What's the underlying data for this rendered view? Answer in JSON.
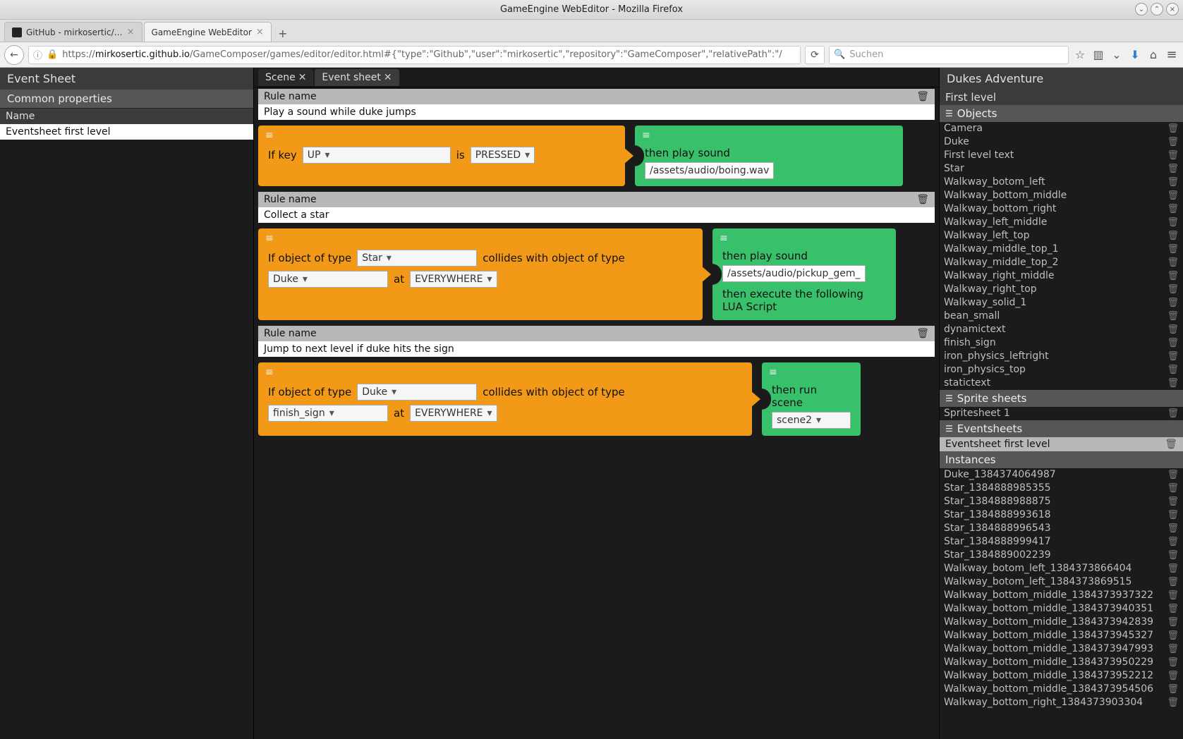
{
  "window": {
    "title": "GameEngine WebEditor - Mozilla Firefox"
  },
  "browser_tabs": [
    {
      "label": "GitHub - mirkosertic/…"
    },
    {
      "label": "GameEngine WebEditor"
    }
  ],
  "url": {
    "scheme": "https://",
    "host": "mirkosertic.github.io",
    "path": "/GameComposer/games/editor/editor.html#{\"type\":\"Github\",\"user\":\"mirkosertic\",\"repository\":\"GameComposer\",\"relativePath\":\"/"
  },
  "search_placeholder": "Suchen",
  "left": {
    "title": "Event Sheet",
    "section": "Common properties",
    "prop_name_label": "Name",
    "prop_name_value": "Eventsheet first level"
  },
  "doc_tabs": [
    {
      "label": "Scene",
      "active": false
    },
    {
      "label": "Event sheet",
      "active": true
    }
  ],
  "rules": [
    {
      "header": "Rule name",
      "name": "Play a sound while duke jumps",
      "orange": {
        "text1": "If key",
        "sel1": "UP",
        "text2": "is",
        "sel2": "PRESSED"
      },
      "green": {
        "lines": [
          {
            "label": "then play sound",
            "value": "/assets/audio/boing.wav"
          }
        ]
      },
      "orange_w": 520,
      "green_w": 380
    },
    {
      "header": "Rule name",
      "name": "Collect a star",
      "orange": {
        "text1": "If object of type",
        "sel1": "Star",
        "text2": "collides with object of type",
        "row2_sel": "Duke",
        "row2_word": "at",
        "row2_sel2": "EVERYWHERE"
      },
      "green": {
        "lines": [
          {
            "label": "then play sound",
            "value": "/assets/audio/pickup_gem_"
          },
          {
            "label": "then execute the following LUA Script"
          }
        ]
      },
      "orange_w": 630,
      "green_w": 260
    },
    {
      "header": "Rule name",
      "name": "Jump to next level if duke hits the sign",
      "orange": {
        "text1": "If object of type",
        "sel1": "Duke",
        "text2": "collides with object of type",
        "row2_sel": "finish_sign",
        "row2_word": "at",
        "row2_sel2": "EVERYWHERE"
      },
      "green": {
        "lines": [
          {
            "label": "then run scene",
            "value": "scene2",
            "is_select": true
          }
        ]
      },
      "orange_w": 700,
      "green_w": 140
    }
  ],
  "right": {
    "project": "Dukes Adventure",
    "scene": "First level",
    "objects_label": "Objects",
    "objects": [
      "Camera",
      "Duke",
      "First level text",
      "Star",
      "Walkway_botom_left",
      "Walkway_bottom_middle",
      "Walkway_bottom_right",
      "Walkway_left_middle",
      "Walkway_left_top",
      "Walkway_middle_top_1",
      "Walkway_middle_top_2",
      "Walkway_right_middle",
      "Walkway_right_top",
      "Walkway_solid_1",
      "bean_small",
      "dynamictext",
      "finish_sign",
      "iron_physics_leftright",
      "iron_physics_top",
      "statictext"
    ],
    "spritesheets_label": "Sprite sheets",
    "spritesheets": [
      "Spritesheet 1"
    ],
    "eventsheets_label": "Eventsheets",
    "eventsheets_selected": "Eventsheet first level",
    "instances_label": "Instances",
    "instances": [
      "Duke_1384374064987",
      "Star_1384888985355",
      "Star_1384888988875",
      "Star_1384888993618",
      "Star_1384888996543",
      "Star_1384888999417",
      "Star_1384889002239",
      "Walkway_botom_left_1384373866404",
      "Walkway_botom_left_1384373869515",
      "Walkway_bottom_middle_1384373937322",
      "Walkway_bottom_middle_1384373940351",
      "Walkway_bottom_middle_1384373942839",
      "Walkway_bottom_middle_1384373945327",
      "Walkway_bottom_middle_1384373947993",
      "Walkway_bottom_middle_1384373950229",
      "Walkway_bottom_middle_1384373952212",
      "Walkway_bottom_middle_1384373954506",
      "Walkway_bottom_right_1384373903304"
    ]
  }
}
